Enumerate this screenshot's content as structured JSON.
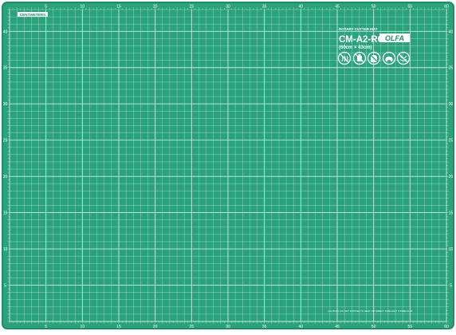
{
  "product": {
    "brand": "OLFA",
    "model": "CM-A2-RC",
    "size_label": "(60cm × 43cm)",
    "subtitle": "ROTARY CUTTER MAT",
    "units_tag": "CENTIMETERS",
    "fine_print": "CAUTION: DO NOT EXPOSE TO HEAT OR DIRECT SUNLIGHT. STORE FLAT."
  },
  "mat": {
    "width_cm": 60,
    "height_cm": 43,
    "top_ruler_labels": [
      "5",
      "10",
      "15",
      "20",
      "25",
      "30",
      "35",
      "40",
      "45",
      "50",
      "55",
      "60"
    ],
    "bottom_ruler_labels": [
      "5",
      "10",
      "15",
      "20",
      "25",
      "30",
      "35",
      "40",
      "45",
      "50",
      "55",
      "60"
    ],
    "left_ruler_labels": [
      "40",
      "35",
      "30",
      "25",
      "20",
      "15",
      "10",
      "5"
    ],
    "right_ruler_labels": [
      "40",
      "35",
      "30",
      "25",
      "20",
      "15",
      "10",
      "5"
    ]
  },
  "care_icons": [
    "heat-warning-icon",
    "no-solvent-icon",
    "no-folding-icon",
    "no-pressure-icon",
    "no-washing-icon"
  ],
  "colors": {
    "mat_green": "#2aa37c",
    "border_green": "#1f8c68",
    "grid_line": "#cfeee3",
    "text_white": "#ffffff"
  }
}
